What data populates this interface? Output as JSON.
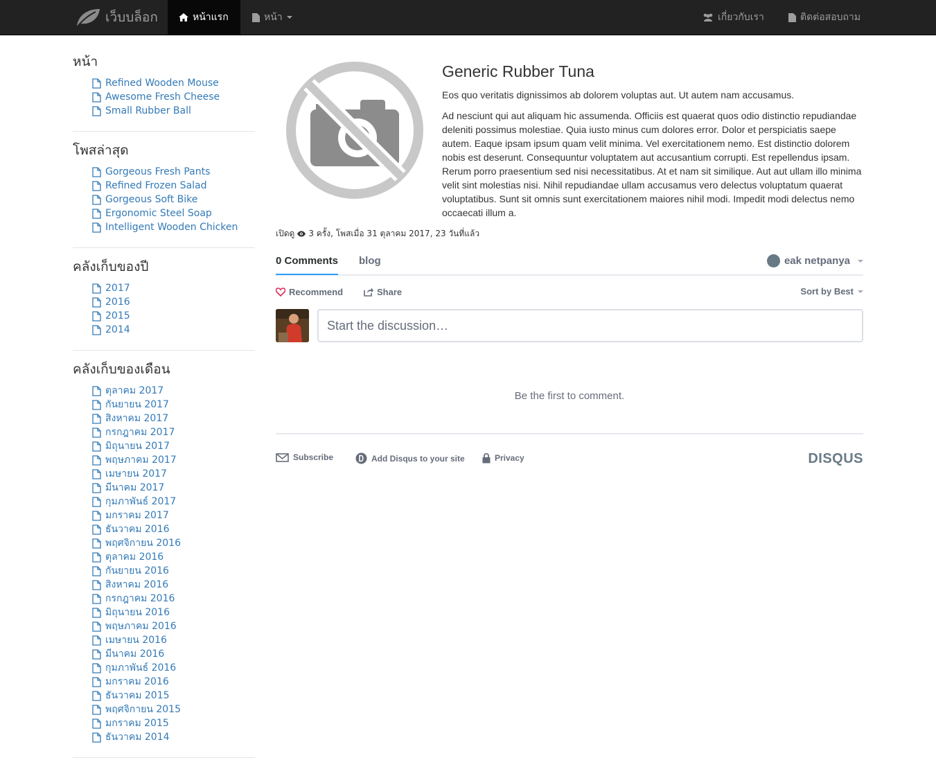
{
  "navbar": {
    "brand": "เว็บบล็อก",
    "home": "หน้าแรก",
    "pages": "หน้า",
    "about": "เกี่ยวกับเรา",
    "contact": "ติดต่อสอบถาม"
  },
  "sidebar": {
    "pages": {
      "title": "หน้า",
      "items": [
        "Refined Wooden Mouse",
        "Awesome Fresh Cheese",
        "Small Rubber Ball"
      ]
    },
    "recent": {
      "title": "โพสล่าสุด",
      "items": [
        "Gorgeous Fresh Pants",
        "Refined Frozen Salad",
        "Gorgeous Soft Bike",
        "Ergonomic Steel Soap",
        "Intelligent Wooden Chicken"
      ]
    },
    "years": {
      "title": "คลังเก็บของปี",
      "items": [
        "2017",
        "2016",
        "2015",
        "2014"
      ]
    },
    "months": {
      "title": "คลังเก็บของเดือน",
      "items": [
        "ตุลาคม 2017",
        "กันยายน 2017",
        "สิงหาคม 2017",
        "กรกฎาคม 2017",
        "มิถุนายน 2017",
        "พฤษภาคม 2017",
        "เมษายน 2017",
        "มีนาคม 2017",
        "กุมภาพันธ์ 2017",
        "มกราคม 2017",
        "ธันวาคม 2016",
        "พฤศจิกายน 2016",
        "ตุลาคม 2016",
        "กันยายน 2016",
        "สิงหาคม 2016",
        "กรกฎาคม 2016",
        "มิถุนายน 2016",
        "พฤษภาคม 2016",
        "เมษายน 2016",
        "มีนาคม 2016",
        "กุมภาพันธ์ 2016",
        "มกราคม 2016",
        "ธันวาคม 2015",
        "พฤศจิกายน 2015",
        "มกราคม 2015",
        "ธันวาคม 2014"
      ]
    }
  },
  "post": {
    "title": "Generic Rubber Tuna",
    "lead": "Eos quo veritatis dignissimos ab dolorem voluptas aut. Ut autem nam accusamus.",
    "body": "Ad nesciunt qui aut aliquam hic assumenda. Officiis est quaerat quos odio distinctio repudiandae deleniti possimus molestiae. Quia iusto minus cum dolores error. Dolor et perspiciatis saepe autem. Eaque ipsam ipsum quam velit minima. Vel exercitationem nemo. Est distinctio dolorem nobis est deserunt. Consequuntur voluptatem aut accusantium corrupti. Est repellendus ipsam. Rerum porro praesentium sed nisi necessitatibus. At et nam sit similique. Aut aut ullam illo minima velit sint molestias nisi. Nihil repudiandae ullam accusamus vero delectus voluptatum quaerat voluptatibus. Sunt sit omnis sunt exercitationem maiores nihil modi. Impedit modi delectus nemo occaecati illum a.",
    "meta_prefix": "เปิดดู",
    "meta_rest": "3 ครั้ง, โพสเมื่อ 31 ตุลาคม 2017, 23 วันที่แล้ว"
  },
  "disqus": {
    "comments_tab": "0 Comments",
    "forum_tab": "blog",
    "user": "eak netpanya",
    "recommend": "Recommend",
    "share": "Share",
    "sort": "Sort by Best",
    "composer_placeholder": "Start the discussion…",
    "empty": "Be the first to comment.",
    "subscribe": "Subscribe",
    "add_disqus": "Add Disqus to your site",
    "privacy": "Privacy",
    "logo": "DISQUS"
  },
  "colors": {
    "navbar": "#222222",
    "link": "#337ab7",
    "disqus_accent": "#2e9fff"
  }
}
